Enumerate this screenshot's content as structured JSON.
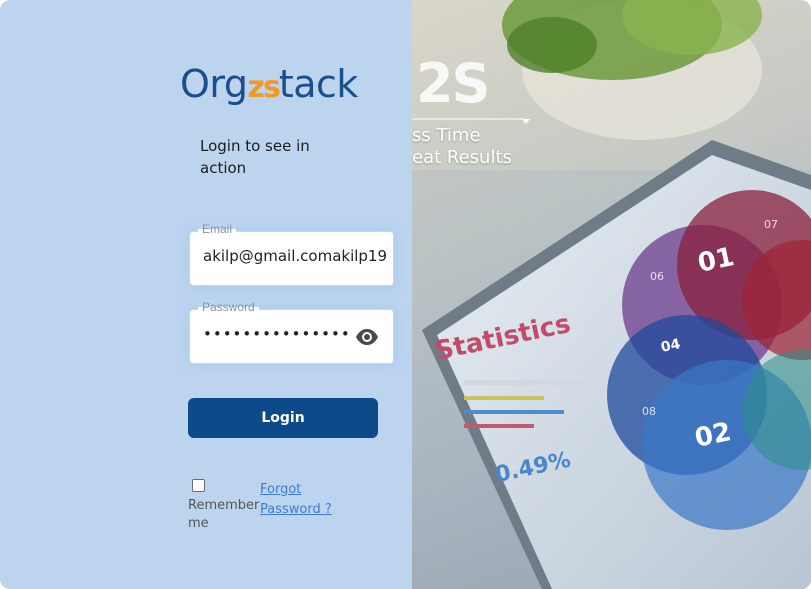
{
  "brand": {
    "logo_prefix": "Org",
    "logo_accent": "zs",
    "logo_suffix": "tack",
    "primary_color": "#1b4e8e",
    "accent_color": "#f29a1f"
  },
  "login": {
    "subtitle": "Login to see in action",
    "email": {
      "label": "Email",
      "value": "akilp@gmail.comakilp19"
    },
    "password": {
      "label": "Password",
      "masked_value": "••••••••••••••••••",
      "toggle_icon": "eye-icon"
    },
    "submit_label": "Login",
    "remember_label": "Remember me",
    "remember_checked": false,
    "forgot_label": "Forgot Password ?"
  },
  "hero": {
    "big_text": "2S",
    "line1": "ss Time",
    "line2": "eat Results",
    "tablet_title": "Statistics",
    "tablet_stat": "0.49%",
    "bubble_labels": [
      "01",
      "02",
      "04",
      "06",
      "07",
      "08"
    ]
  },
  "colors": {
    "panel_bg": "#bcd4ee",
    "button_bg": "#0d4a8a",
    "link": "#3d7cd2"
  }
}
